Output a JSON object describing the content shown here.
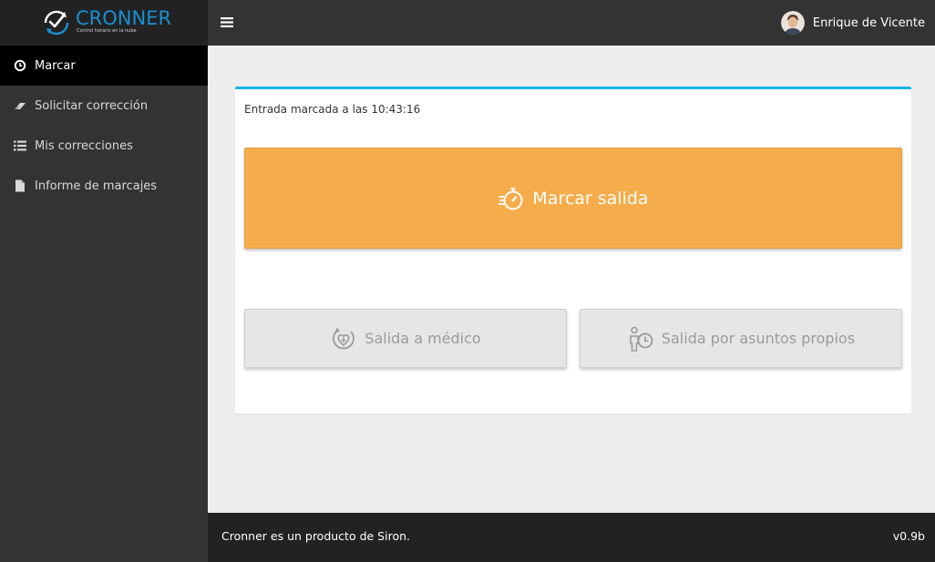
{
  "brand": {
    "name": "CRONNER",
    "tagline": "Control horario en la nube",
    "color": "#1a8fd1"
  },
  "sidebar": {
    "items": [
      {
        "label": "Marcar",
        "icon": "clock-icon",
        "active": true
      },
      {
        "label": "Solicitar corrección",
        "icon": "eraser-icon",
        "active": false
      },
      {
        "label": "Mis correcciones",
        "icon": "list-icon",
        "active": false
      },
      {
        "label": "Informe de marcajes",
        "icon": "file-icon",
        "active": false
      }
    ]
  },
  "header": {
    "menu_icon": "hamburger-icon",
    "user_name": "Enrique de Vicente"
  },
  "panel": {
    "status": "Entrada marcada a las 10:43:16",
    "accent": "#1ab5e8",
    "main_button": {
      "label": "Marcar salida",
      "icon": "stopwatch-icon",
      "color": "#f5ac4a"
    },
    "secondary_buttons": [
      {
        "label": "Salida a médico",
        "icon": "medical-icon"
      },
      {
        "label": "Salida por asuntos propios",
        "icon": "person-clock-icon"
      }
    ]
  },
  "footer": {
    "text": "Cronner es un producto de Siron.",
    "version": "v0.9b"
  }
}
